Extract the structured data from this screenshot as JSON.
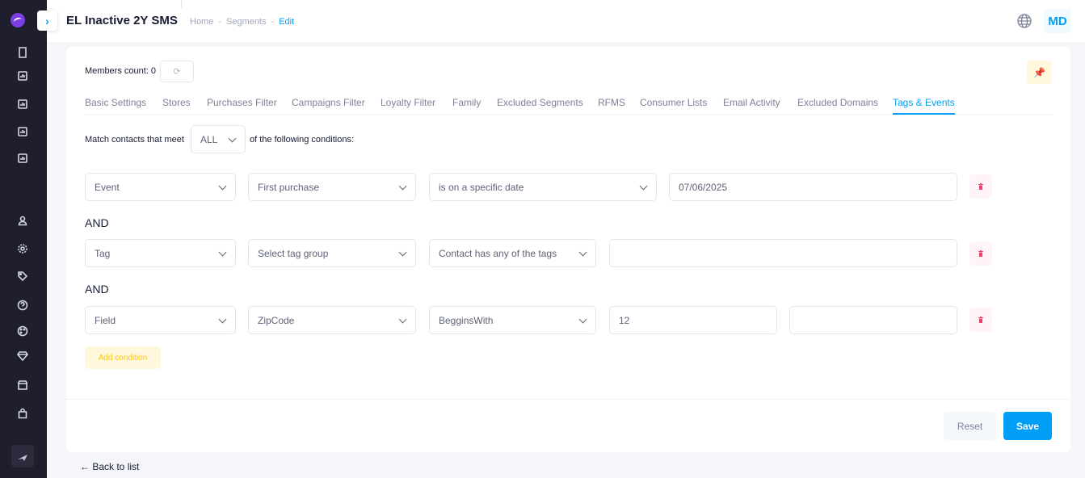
{
  "header": {
    "title": "EL Inactive 2Y SMS",
    "breadcrumb": [
      "Home",
      "Segments",
      "Edit"
    ],
    "avatar_initials": "MD"
  },
  "card": {
    "members_count_label": "Members count: 0",
    "tabs": [
      {
        "label": "Basic Settings"
      },
      {
        "label": "Stores"
      },
      {
        "label": "Purchases Filter"
      },
      {
        "label": "Campaigns Filter"
      },
      {
        "label": "Loyalty Filter"
      },
      {
        "label": "Family"
      },
      {
        "label": "Excluded Segments"
      },
      {
        "label": "RFMS"
      },
      {
        "label": "Consumer Lists"
      },
      {
        "label": "Email Activity"
      },
      {
        "label": "Excluded Domains"
      },
      {
        "label": "Tags & Events",
        "active": true
      }
    ],
    "match": {
      "prefix": "Match contacts that meet",
      "value": "ALL",
      "suffix": "of the following conditions:"
    },
    "and_label": "AND",
    "conditions": [
      {
        "type": "Event",
        "subject": "First purchase",
        "operator": "is on a specific date",
        "value": "07/06/2025"
      },
      {
        "type": "Tag",
        "subject": "Select tag group",
        "operator": "Contact has any of the tags",
        "value": ""
      },
      {
        "type": "Field",
        "subject": "ZipCode",
        "operator": "BegginsWith",
        "value": "12",
        "value2": ""
      }
    ],
    "add_condition_label": "Add condition",
    "reset_label": "Reset",
    "save_label": "Save"
  },
  "back_link": "← Back to list",
  "colors": {
    "primary": "#009ef7",
    "danger": "#f1416c",
    "warning": "#ffc700",
    "sidebar": "#1e1e2d"
  },
  "icons": {
    "sidebar": [
      "logo-icon",
      "file-icon",
      "chart-icon",
      "chart-icon",
      "chart-icon",
      "chart-icon",
      "user-icon",
      "gear-icon",
      "tag-icon",
      "help-icon",
      "palette-icon",
      "diamond-icon",
      "store-icon",
      "bag-icon",
      "send-icon"
    ],
    "header": [
      "chevron-right-icon",
      "globe-icon"
    ],
    "card": [
      "refresh-icon",
      "pin-icon",
      "trash-icon"
    ]
  }
}
